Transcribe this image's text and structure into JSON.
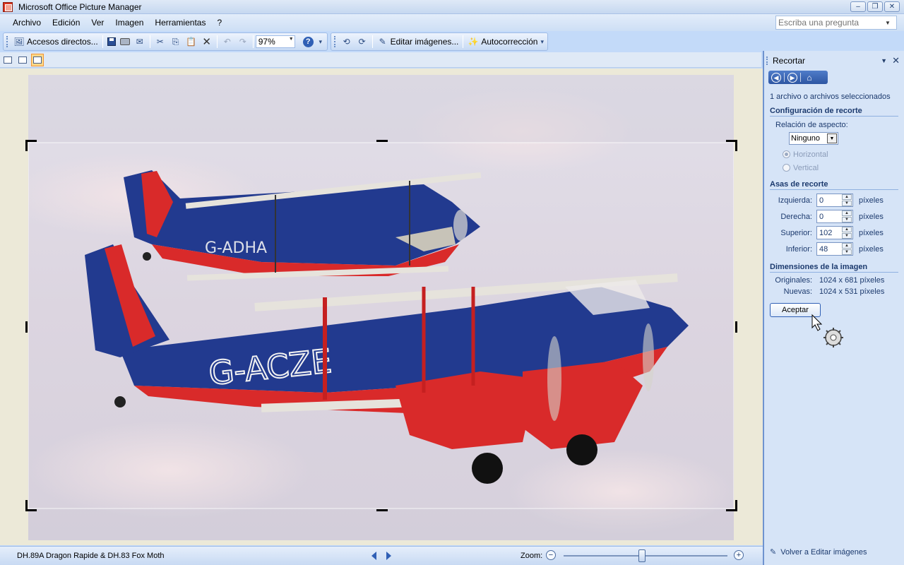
{
  "window": {
    "title": "Microsoft Office Picture Manager",
    "controls": [
      "minimize",
      "restore",
      "close"
    ]
  },
  "menu": {
    "items": [
      "Archivo",
      "Edición",
      "Ver",
      "Imagen",
      "Herramientas",
      "?"
    ],
    "ask_placeholder": "Escriba una pregunta"
  },
  "toolbar": {
    "shortcuts_label": "Accesos directos...",
    "zoom_value": "97%",
    "edit_images_label": "Editar imágenes...",
    "autocorrect_label": "Autocorrección",
    "icons": [
      "save-icon",
      "print-icon",
      "email-icon",
      "cut-icon",
      "copy-icon",
      "paste-icon",
      "delete-icon",
      "undo-icon",
      "redo-icon",
      "help-icon",
      "rotate-left-icon",
      "rotate-right-icon"
    ]
  },
  "views": {
    "items": [
      "thumbnail-view",
      "filmstrip-view",
      "single-picture-view"
    ],
    "active": "single-picture-view"
  },
  "status": {
    "filename": "DH.89A Dragon Rapide & DH.83 Fox Moth",
    "zoom_label": "Zoom:",
    "zoom_slider_fraction": 0.48
  },
  "photo": {
    "aircraft": [
      {
        "registration": "G-ACZE",
        "colors": {
          "fuselage": "#223a8f",
          "underside": "#d92a2a"
        }
      },
      {
        "registration": "G-ADHA",
        "colors": {
          "fuselage": "#223a8f",
          "underside": "#d92a2a"
        }
      }
    ]
  },
  "taskpane": {
    "title": "Recortar",
    "selected_text": "1 archivo o archivos seleccionados",
    "crop_settings_heading": "Configuración de recorte",
    "aspect_ratio_label": "Relación de aspecto:",
    "aspect_ratio_value": "Ninguno",
    "orientation": {
      "horizontal": "Horizontal",
      "vertical": "Vertical",
      "selected": "Horizontal"
    },
    "crop_handles_heading": "Asas de recorte",
    "fields": [
      {
        "label": "Izquierda:",
        "value": "0",
        "unit": "píxeles"
      },
      {
        "label": "Derecha:",
        "value": "0",
        "unit": "píxeles"
      },
      {
        "label": "Superior:",
        "value": "102",
        "unit": "píxeles"
      },
      {
        "label": "Inferior:",
        "value": "48",
        "unit": "píxeles"
      }
    ],
    "dimensions_heading": "Dimensiones de la imagen",
    "original_label": "Originales:",
    "original_value": "1024 x 681 píxeles",
    "new_label": "Nuevas:",
    "new_value": "1024 x 531 píxeles",
    "accept_label": "Aceptar",
    "footer_link": "Volver a Editar imágenes"
  },
  "colors": {
    "accent": "#2f5fb5",
    "pane_bg": "#d6e4f7",
    "canvas_bg": "#ece9d8"
  }
}
